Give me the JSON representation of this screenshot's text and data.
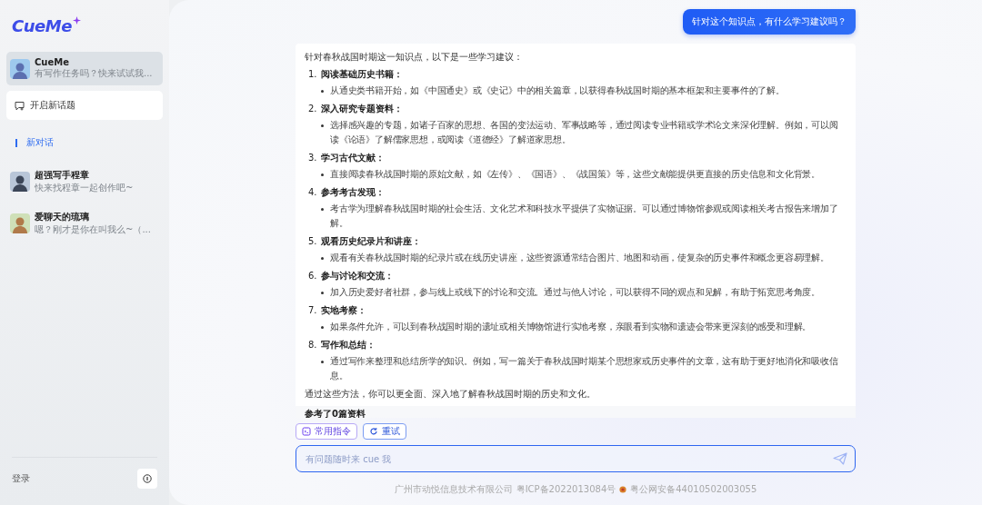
{
  "logo": {
    "text": "CueMe"
  },
  "sidebar": {
    "pinned_bot": {
      "name": "CueMe",
      "preview": "有写作任务吗？快来试试我...",
      "selected": true
    },
    "new_topic_button": "开启新话题",
    "history": {
      "label": "新对话",
      "items": [
        {
          "name": "超强写手程章",
          "preview": "快来找程章一起创作吧~",
          "selected": false
        },
        {
          "name": "爱聊天的琉璃",
          "preview": "嗯？刚才是你在叫我么~（...",
          "selected": false
        }
      ]
    },
    "login": "登录"
  },
  "chat": {
    "messages": [
      {
        "kind": "user",
        "text": "针对这个知识点，有什么学习建议吗？"
      },
      {
        "kind": "assistant",
        "intro": "针对春秋战国时期这一知识点，以下是一些学习建议：",
        "sections": [
          {
            "number": "1.",
            "title": "阅读基础历史书籍：",
            "bullets": [
              "从通史类书籍开始，如《中国通史》或《史记》中的相关篇章，以获得春秋战国时期的基本框架和主要事件的了解。"
            ]
          },
          {
            "number": "2.",
            "title": "深入研究专题资料：",
            "bullets": [
              "选择感兴趣的专题，如诸子百家的思想、各国的变法运动、军事战略等，通过阅读专业书籍或学术论文来深化理解。例如，可以阅读《论语》了解儒家思想，或阅读《道德经》了解道家思想。"
            ]
          },
          {
            "number": "3.",
            "title": "学习古代文献：",
            "bullets": [
              "直接阅读春秋战国时期的原始文献，如《左传》、《国语》、《战国策》等，这些文献能提供更直接的历史信息和文化背景。"
            ]
          },
          {
            "number": "4.",
            "title": "参考考古发现：",
            "bullets": [
              "考古学为理解春秋战国时期的社会生活、文化艺术和科技水平提供了实物证据。可以通过博物馆参观或阅读相关考古报告来增加了解。"
            ]
          },
          {
            "number": "5.",
            "title": "观看历史纪录片和讲座：",
            "bullets": [
              "观看有关春秋战国时期的纪录片或在线历史讲座，这些资源通常结合图片、地图和动画，使复杂的历史事件和概念更容易理解。"
            ]
          },
          {
            "number": "6.",
            "title": "参与讨论和交流：",
            "bullets": [
              "加入历史爱好者社群，参与线上或线下的讨论和交流。通过与他人讨论，可以获得不同的观点和见解，有助于拓宽思考角度。"
            ]
          },
          {
            "number": "7.",
            "title": "实地考察：",
            "bullets": [
              "如果条件允许，可以到春秋战国时期的遗址或相关博物馆进行实地考察，亲眼看到实物和遗迹会带来更深刻的感受和理解。"
            ]
          },
          {
            "number": "8.",
            "title": "写作和总结：",
            "bullets": [
              "通过写作来整理和总结所学的知识。例如，写一篇关于春秋战国时期某个思想家或历史事件的文章，这有助于更好地消化和吸收信息。"
            ]
          }
        ],
        "outro": "通过这些方法，你可以更全面、深入地了解春秋战国时期的历史和文化。"
      }
    ],
    "references": "参考了0篇资料",
    "quick_actions": [
      {
        "label": "常用指令",
        "kind": "command"
      },
      {
        "label": "重试",
        "kind": "retry"
      }
    ],
    "input": {
      "placeholder": "有问题随时来 cue 我"
    }
  },
  "footer": {
    "company": "广州市动悦信息技术有限公司",
    "icp": "粤ICP备2022013084号",
    "police": "粤公网安备44010502003055"
  }
}
